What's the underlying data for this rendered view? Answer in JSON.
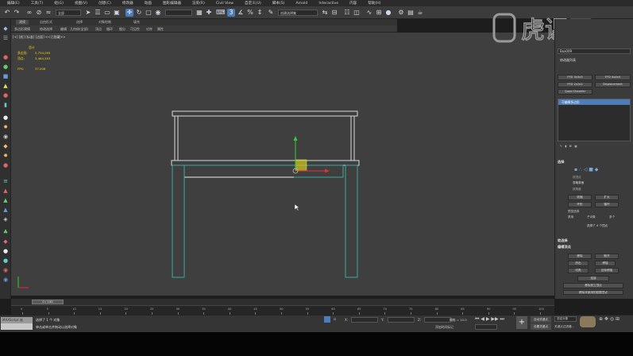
{
  "menu": [
    "编辑(E)",
    "工具(T)",
    "组(G)",
    "视图(V)",
    "创建(C)",
    "修改器",
    "动画",
    "图形编辑器",
    "渲染(R)",
    "Civil View",
    "自定义(U)",
    "脚本(S)",
    "Arnold",
    "Interactive",
    "内容",
    "帮助(H)"
  ],
  "toolbar": {
    "selection_filter": "全部",
    "named_set": "创建选择集",
    "snap_value": "3"
  },
  "ribbon": {
    "tabs": [
      "建模",
      "自由形式",
      "选择",
      "对象绘制",
      "填充"
    ],
    "selected_tab": "建模",
    "sub_items": [
      "多边形建模",
      "修改选择",
      "编辑",
      "几何体(全部)",
      "顶点",
      "循环",
      "细分",
      "可见性",
      "对齐",
      "属性"
    ]
  },
  "viewport": {
    "label": "[+] [前] [标准] [边面] <<已隐藏>>",
    "stats": {
      "header": "总计",
      "polys_label": "多边形:",
      "polys_value": "5,734,095",
      "verts_label": "顶点:",
      "verts_value": "3,464,553",
      "fps_label": "FPS:",
      "fps_value": "37.006"
    }
  },
  "command_panel": {
    "object_name": "Box009",
    "modifier_list": "修改器列表",
    "buttons": [
      "FFD 3x3x3",
      "FFD 4x4x4",
      "FFD 2x2x2",
      "Displacement",
      "Quad Chamfer"
    ],
    "stack_item": "可编辑多边形",
    "selection_head": "选择",
    "by_vertex": "按顶点",
    "ignore_backface": "忽略背面",
    "by_angle": "按角度",
    "shrink": "收缩",
    "grow": "扩大",
    "ring": "环形",
    "loop": "循环",
    "preview_selection": "预览选择",
    "off": "禁用",
    "subobject": "子对象",
    "multi": "多个",
    "selected_info": "选择了 4 个顶点",
    "soft_selection": "软选择",
    "edit_vertices": "编辑顶点",
    "remove": "移除",
    "break": "断开",
    "extrude": "挤出",
    "weld": "焊接",
    "chamfer": "切角",
    "target_weld": "目标焊接",
    "connect": "连接",
    "remove_isolated": "移除孤立顶点",
    "remove_unused": "移除未使用的贴图顶点"
  },
  "timeline": {
    "frame": "0 / 100",
    "ticks": [
      "0",
      "5",
      "10",
      "15",
      "20",
      "25",
      "30",
      "35",
      "40",
      "45",
      "50",
      "55",
      "60",
      "65",
      "70",
      "75",
      "80",
      "85",
      "90",
      "95",
      "100"
    ]
  },
  "status": {
    "maxscript": "MAXScript 迷",
    "line1": "选择了 1 个 对象",
    "line2": "单击或单击并拖动以选择对象",
    "x_label": "X:",
    "y_label": "Y:",
    "z_label": "Z:",
    "grid": "栅格 = 10.0",
    "time_tag": "添加时间标记",
    "auto_key": "自动关键点",
    "set_key": "设置关键点",
    "selected": "选定对象",
    "key_filters": "关键点过滤器..."
  },
  "watermark": "虎课网",
  "colors": {
    "accent": "#4d7cb8",
    "viewport_bg": "#3f3f3f",
    "stats": "#ffd400",
    "mesh": "#d8d8d8",
    "selected_mesh": "#3fa7a0",
    "gizmo_x": "#e03030",
    "gizmo_y": "#30d030",
    "gizmo_center": "#c9c020"
  }
}
